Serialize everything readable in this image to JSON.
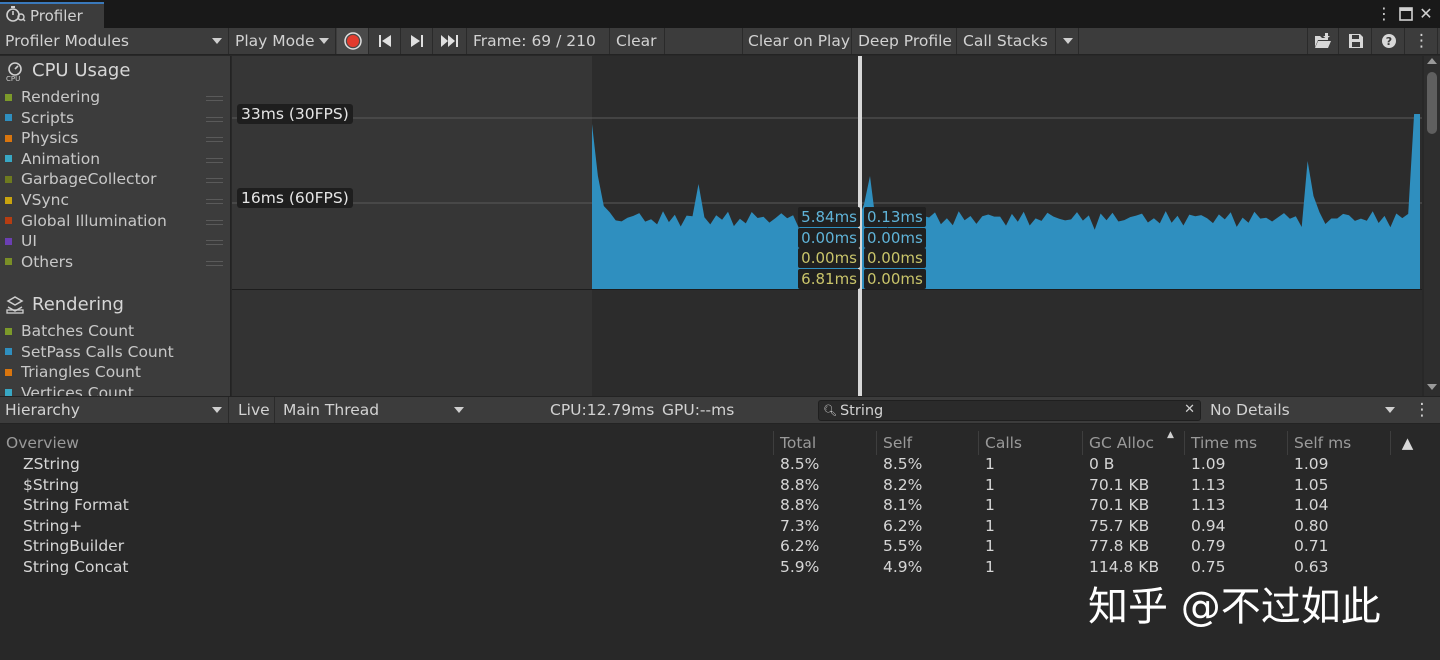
{
  "window": {
    "tab_title": "Profiler",
    "menu_icon": "kebab-icon",
    "maximize_icon": "maximize-icon",
    "close_icon": "close-icon"
  },
  "toolbar": {
    "modules_dropdown": "Profiler Modules",
    "play_mode": "Play Mode",
    "frame_label": "Frame: 69 / 210",
    "clear": "Clear",
    "clear_on_play": "Clear on Play",
    "deep_profile": "Deep Profile",
    "call_stacks": "Call Stacks"
  },
  "modules": {
    "cpu": {
      "title": "CPU Usage",
      "items": [
        {
          "label": "Rendering",
          "color": "#7c9a2a"
        },
        {
          "label": "Scripts",
          "color": "#2f8fbf"
        },
        {
          "label": "Physics",
          "color": "#d9750e"
        },
        {
          "label": "Animation",
          "color": "#38a7c4"
        },
        {
          "label": "GarbageCollector",
          "color": "#6e7a1f"
        },
        {
          "label": "VSync",
          "color": "#c9a40f"
        },
        {
          "label": "Global Illumination",
          "color": "#b63d12"
        },
        {
          "label": "UI",
          "color": "#6b3fb3"
        },
        {
          "label": "Others",
          "color": "#7a8f26"
        }
      ]
    },
    "rendering": {
      "title": "Rendering",
      "items": [
        {
          "label": "Batches Count",
          "color": "#7c9a2a"
        },
        {
          "label": "SetPass Calls Count",
          "color": "#2f8fbf"
        },
        {
          "label": "Triangles Count",
          "color": "#d9750e"
        },
        {
          "label": "Vertices Count",
          "color": "#38a7c4"
        }
      ]
    }
  },
  "chart": {
    "fps30": "33ms (30FPS)",
    "fps60": "16ms (60FPS)",
    "tooltip_left": [
      "5.84ms",
      "0.00ms",
      "0.00ms",
      "6.81ms"
    ],
    "tooltip_right": [
      "0.13ms",
      "0.00ms",
      "0.00ms",
      "0.00ms"
    ]
  },
  "hierarchy_bar": {
    "view_dropdown": "Hierarchy",
    "live": "Live",
    "thread_dropdown": "Main Thread",
    "cpu_time": "CPU:12.79ms",
    "gpu_time": "GPU:--ms",
    "search_value": "String",
    "details_dropdown": "No Details"
  },
  "table": {
    "columns": [
      "Overview",
      "Total",
      "Self",
      "Calls",
      "GC Alloc",
      "Time ms",
      "Self ms"
    ],
    "rows": [
      [
        "ZString",
        "8.5%",
        "8.5%",
        "1",
        "0 B",
        "1.09",
        "1.09"
      ],
      [
        "$String",
        "8.8%",
        "8.2%",
        "1",
        "70.1 KB",
        "1.13",
        "1.05"
      ],
      [
        "String Format",
        "8.8%",
        "8.1%",
        "1",
        "70.1 KB",
        "1.13",
        "1.04"
      ],
      [
        "String+",
        "7.3%",
        "6.2%",
        "1",
        "75.7 KB",
        "0.94",
        "0.80"
      ],
      [
        "StringBuilder",
        "6.2%",
        "5.5%",
        "1",
        "77.8 KB",
        "0.79",
        "0.71"
      ],
      [
        "String Concat",
        "5.9%",
        "4.9%",
        "1",
        "114.8 KB",
        "0.75",
        "0.63"
      ]
    ]
  },
  "watermark": "知乎 @不过如此"
}
